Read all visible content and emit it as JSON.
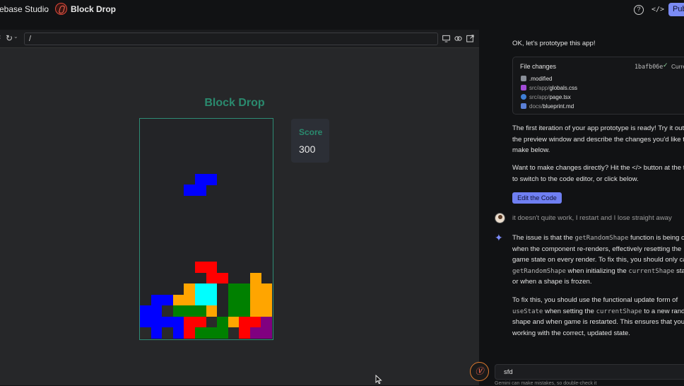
{
  "header": {
    "studio_name": "ebase Studio",
    "separator": "›",
    "app_name": "Block Drop",
    "help_glyph": "?",
    "code_glyph": "</>",
    "publish_label": "Pub"
  },
  "urlbar": {
    "url": "/"
  },
  "game": {
    "title": "Block Drop",
    "score_label": "Score",
    "score_value": "300",
    "board": {
      "cols": 12,
      "rows": 20,
      "colors": {
        "blue": "#0000ff",
        "red": "#ff0000",
        "orange": "#ffa500",
        "cyan": "#00ffff",
        "green": "#008000",
        "purple": "#800080",
        "dark": "#2a2a2a"
      },
      "cells": [
        {
          "col": 5,
          "row": 5,
          "color": "blue"
        },
        {
          "col": 6,
          "row": 5,
          "color": "blue"
        },
        {
          "col": 4,
          "row": 6,
          "color": "blue"
        },
        {
          "col": 5,
          "row": 6,
          "color": "blue"
        },
        {
          "col": 5,
          "row": 13,
          "color": "red"
        },
        {
          "col": 6,
          "row": 13,
          "color": "red"
        },
        {
          "col": 6,
          "row": 14,
          "color": "red"
        },
        {
          "col": 7,
          "row": 14,
          "color": "red"
        },
        {
          "col": 10,
          "row": 14,
          "color": "orange"
        },
        {
          "col": 4,
          "row": 15,
          "color": "orange"
        },
        {
          "col": 5,
          "row": 15,
          "color": "cyan"
        },
        {
          "col": 6,
          "row": 15,
          "color": "cyan"
        },
        {
          "col": 8,
          "row": 15,
          "color": "green"
        },
        {
          "col": 9,
          "row": 15,
          "color": "green"
        },
        {
          "col": 10,
          "row": 15,
          "color": "orange"
        },
        {
          "col": 11,
          "row": 15,
          "color": "orange"
        },
        {
          "col": 1,
          "row": 16,
          "color": "blue"
        },
        {
          "col": 2,
          "row": 16,
          "color": "blue"
        },
        {
          "col": 3,
          "row": 16,
          "color": "orange"
        },
        {
          "col": 4,
          "row": 16,
          "color": "orange"
        },
        {
          "col": 5,
          "row": 16,
          "color": "cyan"
        },
        {
          "col": 6,
          "row": 16,
          "color": "cyan"
        },
        {
          "col": 8,
          "row": 16,
          "color": "green"
        },
        {
          "col": 9,
          "row": 16,
          "color": "green"
        },
        {
          "col": 10,
          "row": 16,
          "color": "orange"
        },
        {
          "col": 11,
          "row": 16,
          "color": "orange"
        },
        {
          "col": 0,
          "row": 17,
          "color": "blue"
        },
        {
          "col": 1,
          "row": 17,
          "color": "blue"
        },
        {
          "col": 2,
          "row": 17,
          "color": "dark"
        },
        {
          "col": 3,
          "row": 17,
          "color": "green"
        },
        {
          "col": 4,
          "row": 17,
          "color": "green"
        },
        {
          "col": 5,
          "row": 17,
          "color": "green"
        },
        {
          "col": 6,
          "row": 17,
          "color": "orange"
        },
        {
          "col": 8,
          "row": 17,
          "color": "green"
        },
        {
          "col": 9,
          "row": 17,
          "color": "green"
        },
        {
          "col": 10,
          "row": 17,
          "color": "orange"
        },
        {
          "col": 11,
          "row": 17,
          "color": "orange"
        },
        {
          "col": 0,
          "row": 18,
          "color": "blue"
        },
        {
          "col": 1,
          "row": 18,
          "color": "blue"
        },
        {
          "col": 2,
          "row": 18,
          "color": "blue"
        },
        {
          "col": 3,
          "row": 18,
          "color": "blue"
        },
        {
          "col": 4,
          "row": 18,
          "color": "red"
        },
        {
          "col": 5,
          "row": 18,
          "color": "red"
        },
        {
          "col": 6,
          "row": 18,
          "color": "dark"
        },
        {
          "col": 7,
          "row": 18,
          "color": "green"
        },
        {
          "col": 8,
          "row": 18,
          "color": "orange"
        },
        {
          "col": 9,
          "row": 18,
          "color": "red"
        },
        {
          "col": 10,
          "row": 18,
          "color": "red"
        },
        {
          "col": 11,
          "row": 18,
          "color": "purple"
        },
        {
          "col": 0,
          "row": 19,
          "color": "dark"
        },
        {
          "col": 1,
          "row": 19,
          "color": "blue"
        },
        {
          "col": 2,
          "row": 19,
          "color": "dark"
        },
        {
          "col": 3,
          "row": 19,
          "color": "blue"
        },
        {
          "col": 4,
          "row": 19,
          "color": "red"
        },
        {
          "col": 5,
          "row": 19,
          "color": "green"
        },
        {
          "col": 6,
          "row": 19,
          "color": "green"
        },
        {
          "col": 7,
          "row": 19,
          "color": "green"
        },
        {
          "col": 8,
          "row": 19,
          "color": "dark"
        },
        {
          "col": 9,
          "row": 19,
          "color": "red"
        },
        {
          "col": 10,
          "row": 19,
          "color": "purple"
        },
        {
          "col": 11,
          "row": 19,
          "color": "purple"
        }
      ]
    }
  },
  "chat": {
    "intro": "OK, let's prototype this app!",
    "file_changes": {
      "title": "File changes",
      "hash": "1bafb06e",
      "status": "Curre",
      "files": [
        {
          "dir": "",
          "name": ".modified",
          "icon_color": "#8a8f99"
        },
        {
          "dir": "src/app/",
          "name": "globals.css",
          "icon_color": "#a24bd6"
        },
        {
          "dir": "src/app/",
          "name": "page.tsx",
          "icon_color": "#3f7fd6"
        },
        {
          "dir": "docs/",
          "name": "blueprint.md",
          "icon_color": "#5a7fd6"
        }
      ]
    },
    "ready_lines": [
      "The first iteration of your app prototype is ready! Try it out",
      "the preview window and describe the changes you'd like t",
      "make below."
    ],
    "direct_lines": [
      "Want to make changes directly? Hit the </> button at the t",
      "to switch to the code editor, or click below."
    ],
    "edit_code_label": "Edit the Code",
    "user_message": "it doesn't quite work, I restart and I lose straight away",
    "reply_para1": [
      {
        "pre": "The issue is that the ",
        "code": "getRandomShape",
        "post": " function is being ca"
      },
      {
        "pre": "when the component re-renders, effectively resetting the",
        "code": "",
        "post": ""
      },
      {
        "pre": "game state on every render. To fix this, you should only ca",
        "code": "",
        "post": ""
      },
      {
        "pre": "",
        "code": "getRandomShape",
        "post": " when initializing the "
      },
      {
        "pre": "or when a shape is frozen.",
        "code": "",
        "post": ""
      }
    ],
    "reply_para1_line4_code2": "currentShape",
    "reply_para1_line4_tail": " sta",
    "reply_para2": [
      {
        "pre": "To fix this, you should use the functional update form of",
        "code": "",
        "post": ""
      },
      {
        "pre": "",
        "code": "useState",
        "post": " when setting the "
      },
      {
        "pre": "shape and when game is restarted. This ensures that you'",
        "code": "",
        "post": ""
      },
      {
        "pre": "working with the correct, updated state.",
        "code": "",
        "post": ""
      }
    ],
    "reply_para2_line2_code2": "currentShape",
    "reply_para2_line2_tail": " to a new rand",
    "input_value": "sfd",
    "disclaimer": "Gemini can make mistakes, so double-check it"
  }
}
